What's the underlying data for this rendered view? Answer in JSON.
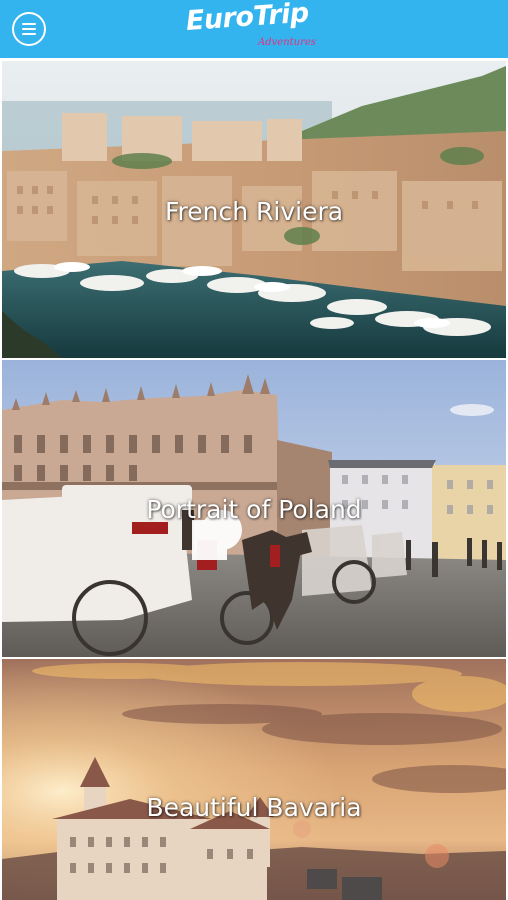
{
  "header": {
    "logo_main": "EuroTrip",
    "logo_sub": "Adventures",
    "background_color": "#33b4ee",
    "menu_icon": "hamburger-menu-icon"
  },
  "destinations": [
    {
      "label": "French Riviera"
    },
    {
      "label": "Portrait of Poland"
    },
    {
      "label": "Beautiful Bavaria"
    }
  ]
}
